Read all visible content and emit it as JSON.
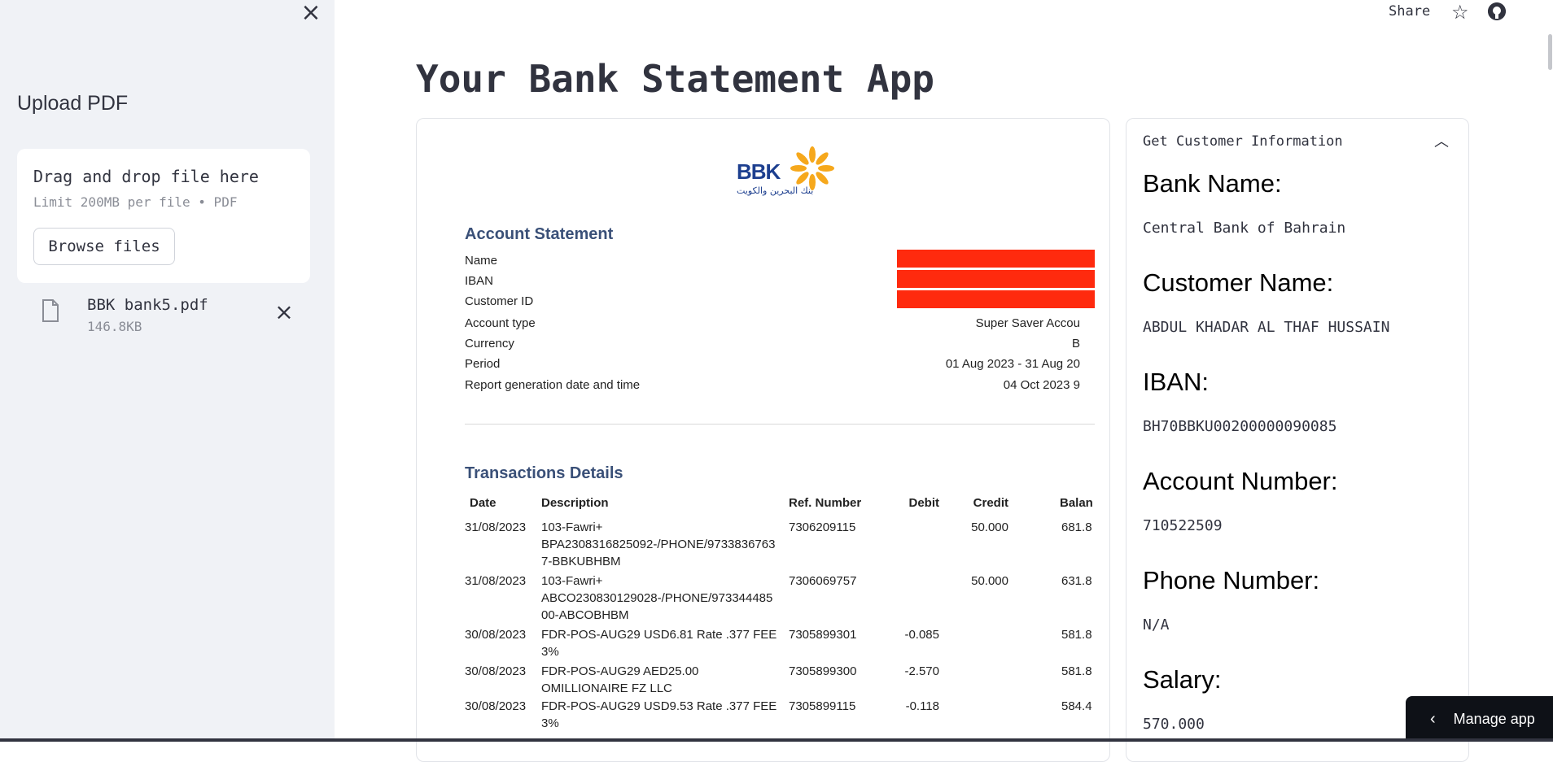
{
  "sidebar": {
    "close_icon": "close-icon",
    "heading": "Upload PDF",
    "uploader": {
      "drag_text": "Drag and drop file here",
      "limit_text": "Limit 200MB per file • PDF",
      "browse_label": "Browse files"
    },
    "file": {
      "icon": "file-icon",
      "name": "BBK bank5.pdf",
      "size": "146.8KB"
    }
  },
  "topbar": {
    "share_label": "Share",
    "star_icon": "star-icon",
    "github_icon": "github-icon"
  },
  "main": {
    "title": "Your Bank Statement App"
  },
  "statement": {
    "logo_text": "BBK",
    "logo_arabic": "بنك البحرين والكويت",
    "account_title": "Account Statement",
    "info": [
      {
        "label": "Name",
        "value": "",
        "redacted": true
      },
      {
        "label": "IBAN",
        "value": "",
        "redacted": true
      },
      {
        "label": "Customer ID",
        "value": "",
        "redacted": true
      },
      {
        "label": "Account type",
        "value": "Super Saver Accou",
        "redacted": false
      },
      {
        "label": "Currency",
        "value": "B",
        "redacted": false
      },
      {
        "label": "Period",
        "value": "01 Aug 2023 - 31 Aug 20",
        "redacted": false
      },
      {
        "label": "Report generation date and time",
        "value": "04 Oct 2023 9",
        "redacted": false
      }
    ],
    "transactions_title": "Transactions Details",
    "columns": [
      "Date",
      "Description",
      "Ref. Number",
      "Debit",
      "Credit",
      "Balan"
    ],
    "rows": [
      {
        "date": "31/08/2023",
        "desc": [
          "103-Fawri+",
          "BPA2308316825092-/PHONE/9733836763",
          "7-BBKUBHBM"
        ],
        "ref": "7306209115",
        "debit": "",
        "credit": "50.000",
        "balance": "681.8"
      },
      {
        "date": "31/08/2023",
        "desc": [
          "103-Fawri+",
          "ABCO230830129028-/PHONE/973344485",
          "00-ABCOBHBM"
        ],
        "ref": "7306069757",
        "debit": "",
        "credit": "50.000",
        "balance": "631.8"
      },
      {
        "date": "30/08/2023",
        "desc": [
          "FDR-POS-AUG29 USD6.81 Rate .377 FEE",
          "3%"
        ],
        "ref": "7305899301",
        "debit": "-0.085",
        "credit": "",
        "balance": "581.8"
      },
      {
        "date": "30/08/2023",
        "desc": [
          "FDR-POS-AUG29 AED25.00",
          "OMILLIONAIRE FZ LLC"
        ],
        "ref": "7305899300",
        "debit": "-2.570",
        "credit": "",
        "balance": "581.8"
      },
      {
        "date": "30/08/2023",
        "desc": [
          "FDR-POS-AUG29 USD9.53 Rate .377 FEE",
          "3%"
        ],
        "ref": "7305899115",
        "debit": "-0.118",
        "credit": "",
        "balance": "584.4"
      }
    ]
  },
  "customer": {
    "expander_title": "Get Customer Information",
    "chevron_icon": "chevron-up-icon",
    "fields": [
      {
        "label": "Bank Name:",
        "value": "Central Bank of Bahrain"
      },
      {
        "label": "Customer Name:",
        "value": "ABDUL KHADAR AL THAF HUSSAIN"
      },
      {
        "label": "IBAN:",
        "value": "BH70BBKU00200000090085"
      },
      {
        "label": "Account Number:",
        "value": "710522509"
      },
      {
        "label": "Phone Number:",
        "value": "N/A"
      },
      {
        "label": "Salary:",
        "value": "570.000"
      }
    ]
  },
  "manage_app": {
    "label": "Manage app"
  },
  "colors": {
    "sidebar_bg": "#f0f2f6",
    "redaction": "#ff2a0e",
    "heading_blue": "#3a5078",
    "logo_blue": "#1d3f8f",
    "logo_gold": "#f6a81c"
  }
}
